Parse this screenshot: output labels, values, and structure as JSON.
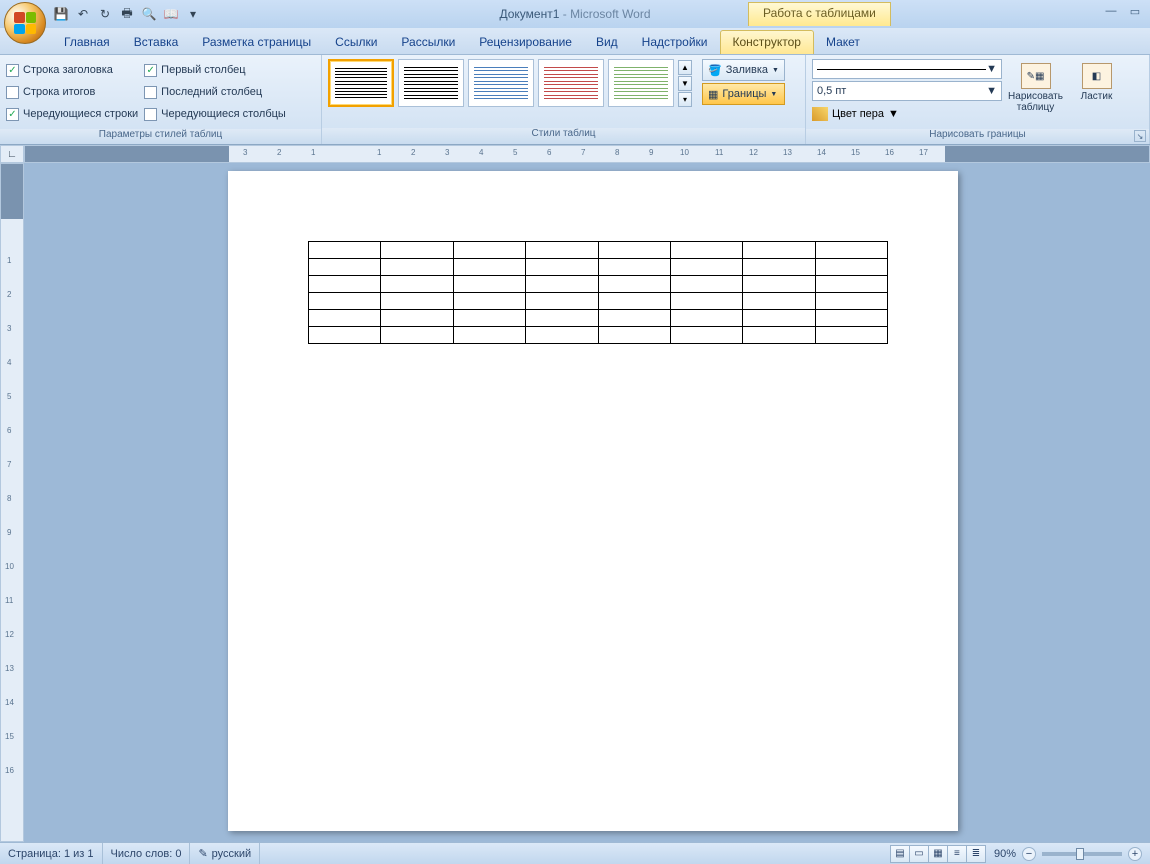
{
  "title": {
    "doc": "Документ1",
    "app": "Microsoft Word"
  },
  "table_tools_label": "Работа с таблицами",
  "tabs": [
    "Главная",
    "Вставка",
    "Разметка страницы",
    "Ссылки",
    "Рассылки",
    "Рецензирование",
    "Вид",
    "Надстройки",
    "Конструктор",
    "Макет"
  ],
  "active_tab_index": 8,
  "style_options": {
    "group_title": "Параметры стилей таблиц",
    "left": [
      {
        "label": "Строка заголовка",
        "checked": true
      },
      {
        "label": "Строка итогов",
        "checked": false
      },
      {
        "label": "Чередующиеся строки",
        "checked": true
      }
    ],
    "right": [
      {
        "label": "Первый столбец",
        "checked": true
      },
      {
        "label": "Последний столбец",
        "checked": false
      },
      {
        "label": "Чередующиеся столбцы",
        "checked": false
      }
    ]
  },
  "table_styles": {
    "group_title": "Стили таблиц",
    "shading_label": "Заливка",
    "borders_label": "Границы",
    "thumbs": [
      {
        "color": "#000000",
        "selected": true
      },
      {
        "color": "#000000",
        "selected": false
      },
      {
        "color": "#4a7ebb",
        "selected": false
      },
      {
        "color": "#c24a4a",
        "selected": false
      },
      {
        "color": "#7fb26b",
        "selected": false
      }
    ]
  },
  "draw_borders": {
    "group_title": "Нарисовать границы",
    "weight": "0,5 пт",
    "pen_color_label": "Цвет пера",
    "draw_label": "Нарисовать таблицу",
    "eraser_label": "Ластик"
  },
  "status": {
    "page": "Страница: 1 из 1",
    "words": "Число слов: 0",
    "lang": "русский",
    "zoom": "90%"
  },
  "document": {
    "table": {
      "rows": 6,
      "cols": 8
    }
  }
}
